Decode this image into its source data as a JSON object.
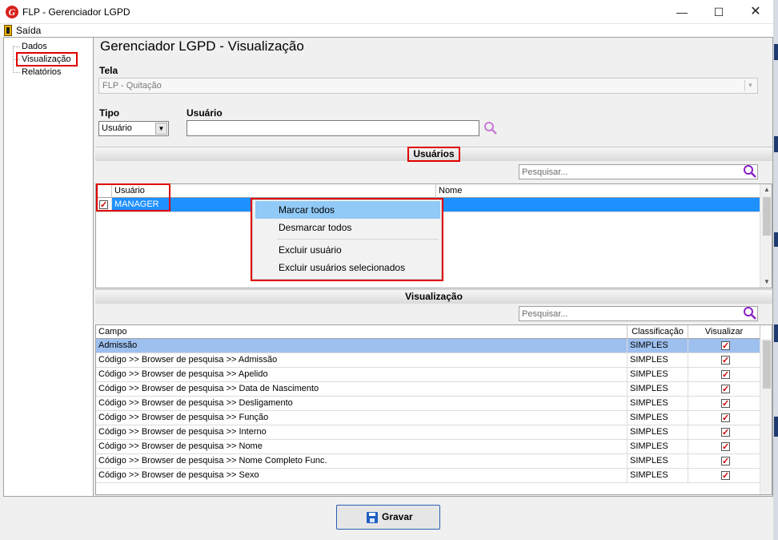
{
  "window": {
    "title": "FLP - Gerenciador LGPD"
  },
  "menu": {
    "exit_label": "Saída"
  },
  "tree": {
    "items": [
      "Dados",
      "Visualização",
      "Relatórios"
    ]
  },
  "page": {
    "title": "Gerenciador LGPD - Visualização"
  },
  "form": {
    "tela_label": "Tela",
    "tela_value": "FLP - Quitação",
    "tipo_label": "Tipo",
    "tipo_value": "Usuário",
    "usuario_label": "Usuário",
    "usuario_value": ""
  },
  "users_section": {
    "title": "Usuários",
    "search_placeholder": "Pesquisar...",
    "columns": [
      "Usuário",
      "Nome"
    ],
    "rows": [
      {
        "usuario": "MANAGER",
        "nome": "",
        "checked": true
      }
    ]
  },
  "context_menu": {
    "items": [
      "Marcar todos",
      "Desmarcar todos",
      "Excluir usuário",
      "Excluir usuários selecionados"
    ]
  },
  "view_section": {
    "title": "Visualização",
    "search_placeholder": "Pesquisar...",
    "columns": [
      "Campo",
      "Classificação",
      "Visualizar"
    ],
    "rows": [
      {
        "campo": "Admissão",
        "classificacao": "SIMPLES",
        "visualizar": true
      },
      {
        "campo": "Código >> Browser de pesquisa >> Admissão",
        "classificacao": "SIMPLES",
        "visualizar": true
      },
      {
        "campo": "Código >> Browser de pesquisa >> Apelido",
        "classificacao": "SIMPLES",
        "visualizar": true
      },
      {
        "campo": "Código >> Browser de pesquisa >> Data de Nascimento",
        "classificacao": "SIMPLES",
        "visualizar": true
      },
      {
        "campo": "Código >> Browser de pesquisa >> Desligamento",
        "classificacao": "SIMPLES",
        "visualizar": true
      },
      {
        "campo": "Código >> Browser de pesquisa >> Função",
        "classificacao": "SIMPLES",
        "visualizar": true
      },
      {
        "campo": "Código >> Browser de pesquisa >> Interno",
        "classificacao": "SIMPLES",
        "visualizar": true
      },
      {
        "campo": "Código >> Browser de pesquisa >> Nome",
        "classificacao": "SIMPLES",
        "visualizar": true
      },
      {
        "campo": "Código >> Browser de pesquisa >> Nome Completo Func.",
        "classificacao": "SIMPLES",
        "visualizar": true
      },
      {
        "campo": "Código >> Browser de pesquisa >> Sexo",
        "classificacao": "SIMPLES",
        "visualizar": true
      }
    ]
  },
  "footer": {
    "save_label": "Gravar"
  },
  "colors": {
    "highlight_red": "#e00000",
    "selection_blue": "#1e90ff",
    "active_row": "#9ec0ef",
    "menu_hover": "#91c9f7"
  }
}
